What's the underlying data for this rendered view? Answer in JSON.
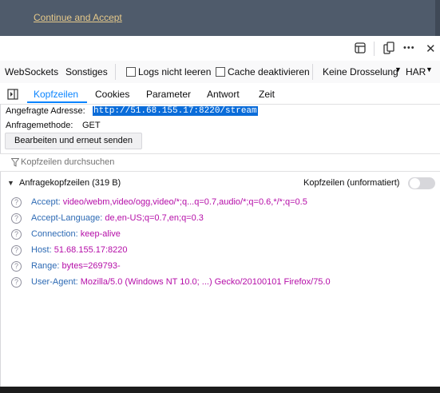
{
  "page": {
    "banner_link": "Continue and Accept"
  },
  "toolbar_top": {
    "icons": [
      "layout-icon",
      "responsive-icon",
      "more-icon",
      "close-icon"
    ],
    "more_label": "•••",
    "close_label": "✕"
  },
  "toolbar_second": {
    "websockets": "WebSockets",
    "sonstiges": "Sonstiges",
    "logs_label": "Logs nicht leeren",
    "cache_label": "Cache deaktivieren",
    "throttle": "Keine Drosselung",
    "har": "HAR"
  },
  "tabs": {
    "kopfzeilen": "Kopfzeilen",
    "cookies": "Cookies",
    "parameter": "Parameter",
    "antwort": "Antwort",
    "zeit": "Zeit"
  },
  "request": {
    "address_label": "Angefragte Adresse:",
    "address_value": "http://51.68.155.17:8220/stream",
    "method_label": "Anfragemethode:",
    "method_value": "GET",
    "resend_button": "Bearbeiten und erneut senden"
  },
  "filter": {
    "placeholder": "Kopfzeilen durchsuchen"
  },
  "headers_section": {
    "title": "Anfragekopfzeilen (319 B)",
    "raw_toggle_label": "Kopfzeilen (unformatiert)",
    "rows": [
      {
        "name": "Accept:",
        "value": "video/webm,video/ogg,video/*;q...q=0.7,audio/*;q=0.6,*/*;q=0.5"
      },
      {
        "name": "Accept-Language:",
        "value": "de,en-US;q=0.7,en;q=0.3"
      },
      {
        "name": "Connection:",
        "value": "keep-alive"
      },
      {
        "name": "Host:",
        "value": "51.68.155.17:8220"
      },
      {
        "name": "Range:",
        "value": "bytes=269793-"
      },
      {
        "name": "User-Agent:",
        "value": "Mozilla/5.0 (Windows NT 10.0; ...) Gecko/20100101 Firefox/75.0"
      }
    ]
  },
  "colors": {
    "accent": "#0a84ff",
    "header_name": "#2d6ab4",
    "header_value": "#b50ea8",
    "banner_bg": "#4f5b6b"
  }
}
